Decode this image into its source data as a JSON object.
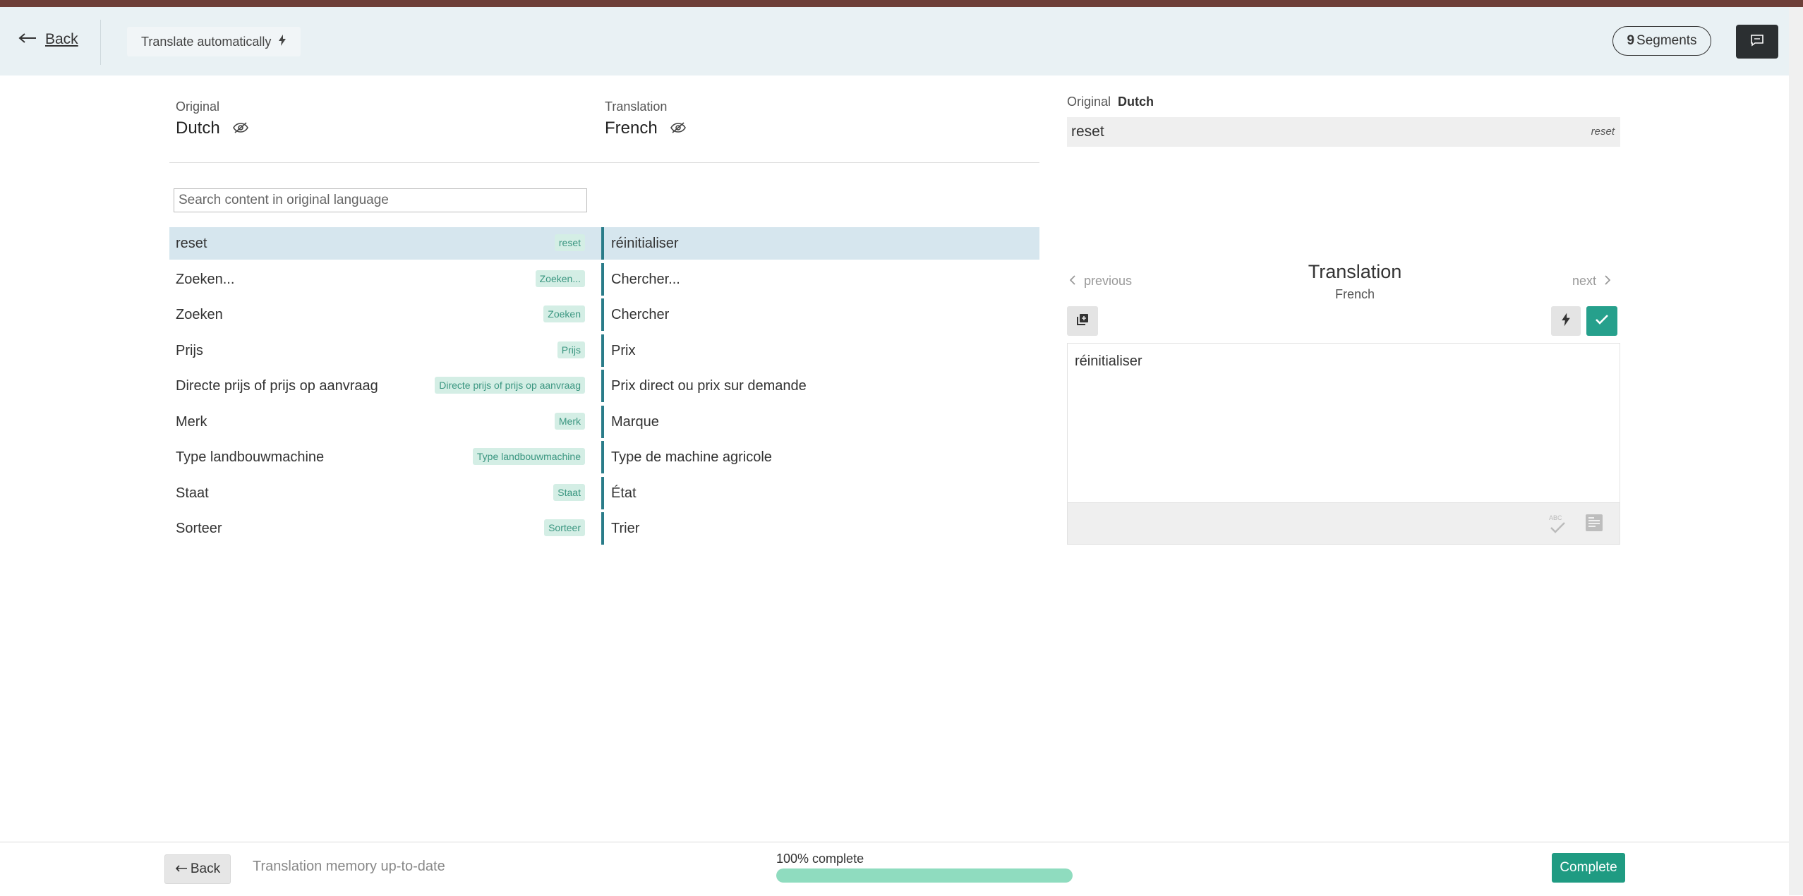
{
  "header": {
    "back_label": "Back",
    "translate_auto_label": "Translate automatically",
    "segment_count": "9",
    "segment_label": "Segments"
  },
  "columns": {
    "original_label": "Original",
    "original_lang": "Dutch",
    "translation_label": "Translation",
    "translation_lang": "French"
  },
  "search": {
    "placeholder": "Search content in original language"
  },
  "segments": [
    {
      "original": "reset",
      "key": "reset",
      "translation": "réinitialiser",
      "selected": true
    },
    {
      "original": "Zoeken...",
      "key": "Zoeken...",
      "translation": "Chercher..."
    },
    {
      "original": "Zoeken",
      "key": "Zoeken",
      "translation": "Chercher"
    },
    {
      "original": "Prijs",
      "key": "Prijs",
      "translation": "Prix"
    },
    {
      "original": "Directe prijs of prijs op aanvraag",
      "key": "Directe prijs of prijs op aanvraag",
      "translation": "Prix direct ou prix sur demande"
    },
    {
      "original": "Merk",
      "key": "Merk",
      "translation": "Marque"
    },
    {
      "original": "Type landbouwmachine",
      "key": "Type landbouwmachine",
      "translation": "Type de machine agricole"
    },
    {
      "original": "Staat",
      "key": "Staat",
      "translation": "État"
    },
    {
      "original": "Sorteer",
      "key": "Sorteer",
      "translation": "Trier"
    }
  ],
  "detail": {
    "original_label": "Original",
    "original_lang": "Dutch",
    "original_value": "reset",
    "original_key": "reset",
    "prev_label": "previous",
    "next_label": "next",
    "title": "Translation",
    "subtitle": "French",
    "translation_value": "réinitialiser"
  },
  "footer": {
    "back_label": "Back",
    "status": "Translation memory up-to-date",
    "progress_label": "100% complete",
    "progress": 1.0,
    "complete_label": "Complete"
  },
  "colors": {
    "accent": "#26a08c",
    "selected_row": "#d6e6ee",
    "row_bar": "#2a7c89",
    "tag_bg": "#d4eee5",
    "progress": "#8fdcbf",
    "topbar": "#e9f1f4"
  },
  "icons": {
    "back": "arrow-left-icon",
    "translate_auto": "lightning-icon",
    "chat": "comment-icon",
    "visibility": "eye-slash-icon",
    "copy": "copy-icon",
    "check": "check-icon",
    "spellcheck": "spellcheck-icon",
    "image": "image-icon"
  }
}
